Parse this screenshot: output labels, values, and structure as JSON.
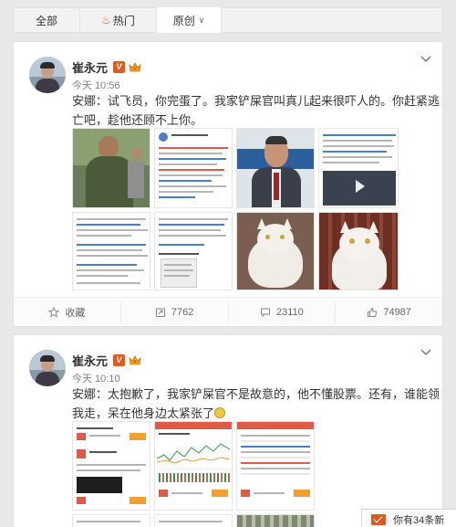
{
  "tabs": {
    "all": "全部",
    "hot": "热门",
    "original": "原创"
  },
  "posts": [
    {
      "user": "崔永元",
      "time": "今天 10:56",
      "text": "安娜：试飞员，你完蛋了。我家铲屎官叫真儿起来很吓人的。你赶紧逃亡吧，趁他还顾不上你。",
      "actions": {
        "favorite": "收藏",
        "repost": "7762",
        "comment": "23110",
        "like": "74987"
      }
    },
    {
      "user": "崔永元",
      "time": "今天 10:10",
      "text": "安娜：太抱歉了，我家铲屎官不是故意的，他不懂股票。还有，谁能领我走，呆在他身边太紧张了"
    }
  ],
  "notification": {
    "text": "你有34条新"
  },
  "colors": {
    "accent": "#e8541e",
    "vip": "#e25b18"
  },
  "icons": [
    "fire-icon",
    "chevron-down-icon",
    "vip-badge-icon",
    "crown-icon",
    "favorite-icon",
    "repost-icon",
    "comment-icon",
    "like-icon",
    "mail-icon"
  ]
}
